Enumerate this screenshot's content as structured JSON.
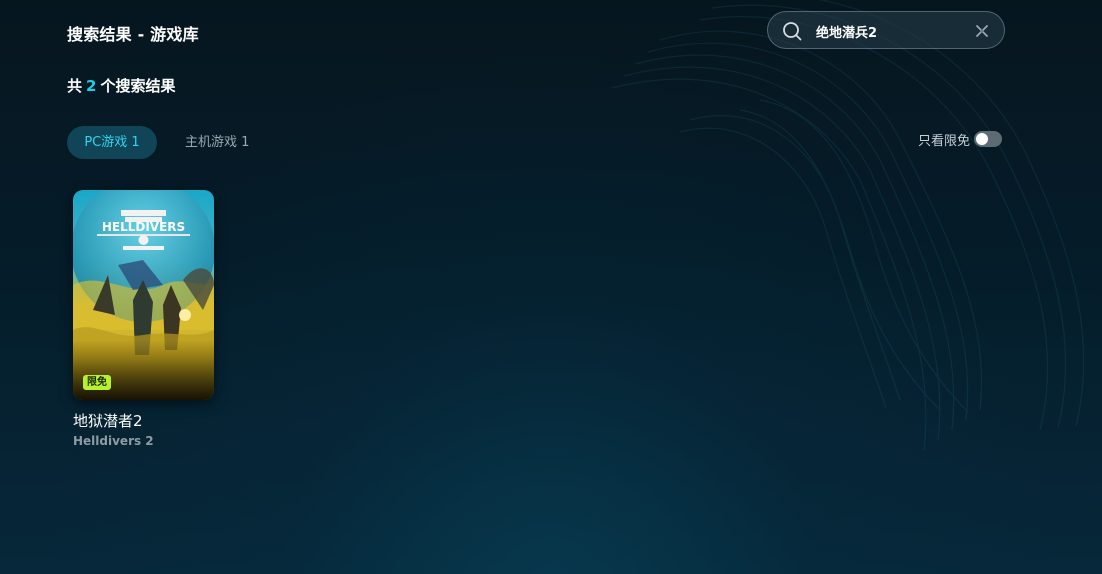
{
  "header": {
    "title": "搜索结果 - 游戏库"
  },
  "search": {
    "value": "绝地潜兵2",
    "icon": "search-icon",
    "clear_icon": "close-icon"
  },
  "results": {
    "prefix": "共",
    "count": "2",
    "suffix": "个搜索结果"
  },
  "tabs": [
    {
      "label": "PC游戏 1",
      "active": true
    },
    {
      "label": "主机游戏 1",
      "active": false
    }
  ],
  "filter": {
    "label": "只看限免",
    "enabled": false
  },
  "games": [
    {
      "title": "地狱潜者2",
      "subtitle": "Helldivers 2",
      "badge": "限免",
      "cover_logo_text": "HELLDIVERS"
    }
  ],
  "colors": {
    "accent": "#19d0ec",
    "tab_active_bg": "#0f4556",
    "badge_bg": "#b7f22c",
    "background": "#051c29"
  }
}
